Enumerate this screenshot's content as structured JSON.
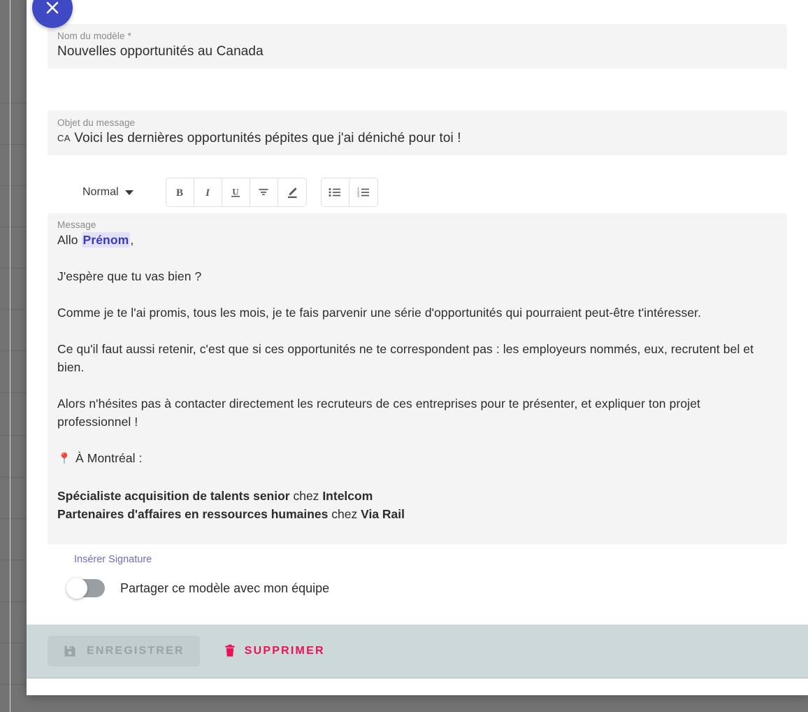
{
  "close_button": {
    "icon": "close-icon"
  },
  "fields": {
    "name": {
      "label": "Nom du modèle *",
      "value": "Nouvelles opportunités au Canada"
    },
    "subject": {
      "label": "Objet du message",
      "prefix": "CA",
      "value": "Voici les dernières opportunités pépites que j'ai déniché pour toi !"
    },
    "message": {
      "label": "Message"
    }
  },
  "toolbar": {
    "style": "Normal",
    "buttons": [
      {
        "name": "bold-icon",
        "glyph": "B"
      },
      {
        "name": "italic-icon",
        "glyph": "I"
      },
      {
        "name": "underline-icon",
        "glyph": "U"
      },
      {
        "name": "strikethrough-icon",
        "glyph": "T"
      },
      {
        "name": "highlight-pen-icon",
        "glyph": "✎"
      }
    ],
    "list_buttons": [
      {
        "name": "bulleted-list-icon",
        "glyph": "≔"
      },
      {
        "name": "numbered-list-icon",
        "glyph": "≡"
      }
    ]
  },
  "message_body": {
    "greeting_before": "Allo ",
    "greeting_tag": "Prénom",
    "greeting_after": ",",
    "paragraphs": [
      "J'espère que tu vas bien ?",
      "Comme je te l'ai promis, tous les mois, je te fais parvenir une série d'opportunités qui pourraient peut-être t'intéresser.",
      "Ce qu'il faut aussi retenir, c'est que si ces opportunités ne te correspondent pas : les employeurs nommés, eux, recrutent bel et bien.",
      "Alors n'hésites pas à contacter directement les recruteurs de ces entreprises pour te présenter, et expliquer ton projet professionnel !"
    ],
    "location_pin": "📍",
    "location": "À Montréal :",
    "listings": [
      {
        "title": "Spécialiste acquisition de talents senior",
        "connector": " chez ",
        "company": "Intelcom"
      },
      {
        "title": "Partenaires d'affaires en ressources humaines",
        "connector": " chez ",
        "company": "Via Rail"
      }
    ]
  },
  "signature_link": "Insérer Signature",
  "share": {
    "label": "Partager ce modèle avec mon équipe",
    "enabled": false
  },
  "footer": {
    "save_label": "ENREGISTRER",
    "save_icon": "save-disk-icon",
    "delete_label": "SUPPRIMER",
    "delete_icon": "trash-icon",
    "save_disabled": true
  },
  "colors": {
    "close_button": "#4049c4",
    "merge_tag_text": "#3b3ab8",
    "merge_tag_bg": "#e2e1f5",
    "delete": "#ec1055",
    "footer_bar": "#ccd8da",
    "link": "#6e6ec4",
    "field_bg": "#f4f4f5"
  }
}
